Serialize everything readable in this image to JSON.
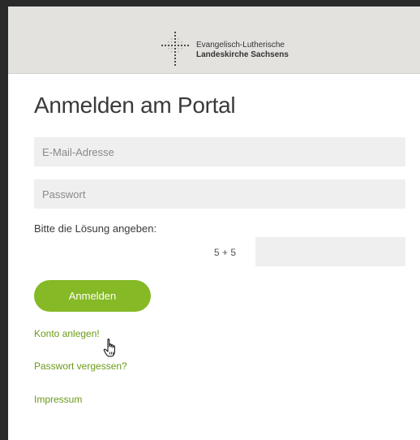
{
  "header": {
    "logo_icon": "cross-dots-icon",
    "logo_line1": "Evangelisch-Lutherische",
    "logo_line2": "Landeskirche Sachsens"
  },
  "login": {
    "title": "Anmelden am Portal",
    "email_placeholder": "E-Mail-Adresse",
    "email_value": "",
    "password_placeholder": "Passwort",
    "password_value": "",
    "captcha_label": "Bitte die Lösung angeben:",
    "captcha_question": "5 + 5",
    "captcha_value": "",
    "submit_label": "Anmelden"
  },
  "links": {
    "register": "Konto anlegen!",
    "forgot_password": "Passwort vergessen?",
    "impressum": "Impressum"
  },
  "cursor": "hand-pointer-icon",
  "colors": {
    "accent": "#85b925",
    "link": "#6a9a18",
    "header_bg": "#e4e2df",
    "field_bg": "#efefef"
  }
}
